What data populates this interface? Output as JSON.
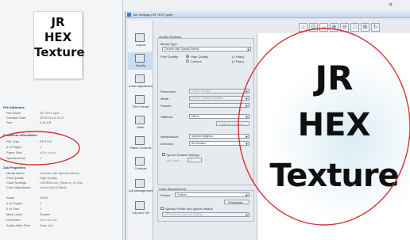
{
  "left_panel": {
    "thumbnail": {
      "line1": "JR",
      "line2": "HEX",
      "line3": "Texture"
    },
    "file_section": {
      "title": "File Attributes",
      "rows": [
        {
          "key": "File Name",
          "value": "JR TEST type"
        },
        {
          "key": "Creation Date",
          "value": "2019/12/16 15:17"
        },
        {
          "key": "Size",
          "value": "3.40 KB"
        }
      ]
    },
    "doc_section": {
      "title": "Document Information",
      "rows": [
        {
          "key": "File Type",
          "value": "EPS File"
        },
        {
          "key": "# of Pages",
          "value": "1"
        },
        {
          "key": "Paper Size",
          "value": "4.5 x 4.4 in"
        },
        {
          "key": "Special Items",
          "value": "1"
        }
      ]
    },
    "job_section": {
      "title": "Job Properties",
      "rows": [
        {
          "key": "Media Name",
          "value": "Generic with Special Effects"
        },
        {
          "key": "Print Quality",
          "value": "High Quality"
        },
        {
          "key": "Color Settings",
          "value": "LSF3000 xxx_Generic_el (GA..."
        },
        {
          "key": "Color Adjustment",
          "value": "Linear (Not Edited)"
        },
        {
          "key": "Scale",
          "value": "100%"
        },
        {
          "key": "# of Copies",
          "value": "1"
        },
        {
          "key": "# of Tiles",
          "value": "1"
        },
        {
          "key": "Mark Label",
          "value": "Disable"
        },
        {
          "key": "Print Area",
          "value": "4.5 x 11.5 in"
        },
        {
          "key": "Action After Print",
          "value": "Save Job"
        }
      ]
    }
  },
  "dialog": {
    "title": "Job Settings (JR TEST type)",
    "close_glyph": "✕",
    "toolbar_glyphs": [
      "⌂",
      "⊡",
      "↔",
      "⊕",
      "⊖",
      "□",
      "⊞",
      "↻"
    ],
    "sidebar": [
      {
        "label": "Layout"
      },
      {
        "label": "Quality"
      },
      {
        "label": "Color Adjustment"
      },
      {
        "label": "File Format"
      },
      {
        "label": "Mark"
      },
      {
        "label": "Plates Controls"
      },
      {
        "label": "Controls"
      },
      {
        "label": "Job Management"
      },
      {
        "label": "Clip and Tile"
      }
    ],
    "quality": {
      "group_title": "Quality Settings",
      "media_type_label": "Media Type:",
      "media_type_value": "Generic with Special Effects",
      "print_quality_label": "Print Quality:",
      "radio_high": "High Quality",
      "radio_high_sub": "(1 Pass)",
      "radio_custom": "Custom",
      "radio_custom_sub": "(2 Pass)",
      "resolution_label": "Resolution:",
      "resolution_value": "1440 x 720 dpi",
      "mode_label": "Mode:",
      "mode_value": "CMYK + Medium Variable",
      "passes_label": "Passes:",
      "passes_value": "",
      "halftone_label": "Halftone:",
      "halftone_value": "Dither",
      "halftone_button": "Halftone Options...",
      "interpolation_label": "Interpolation:",
      "interpolation_value": "Nearest Neighbor",
      "direction_label": "Direction:",
      "direction_value": "Bi-Direction",
      "ignore_label": "Ignore Default Settings",
      "ink_limit_label": "Ink Limit:",
      "ink_limit_value": "0"
    },
    "color": {
      "group_title": "Color Management",
      "preset_label": "Preset:",
      "preset_value": "Custom",
      "properties_button": "Properties...",
      "specify_label": "Specify Profile and Ignore Default",
      "profile_value": "LSF3000 xxx_Generic_JR(GA)..."
    },
    "preview": {
      "line1": "JR",
      "line2": "HEX",
      "line3": "Texture"
    }
  },
  "accent_color": "#d43131"
}
